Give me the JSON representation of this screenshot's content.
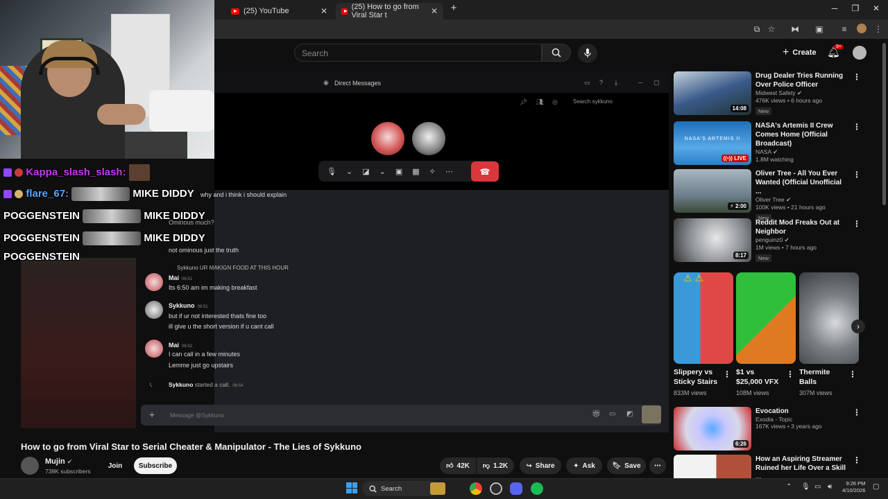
{
  "browser": {
    "tabs": [
      {
        "title": "(25) YouTube"
      },
      {
        "title": "(25) How to go from Viral Star t"
      }
    ],
    "new_tab": "+"
  },
  "youtube_header": {
    "search_placeholder": "Search",
    "create_label": "Create",
    "notification_count": "9+"
  },
  "discord": {
    "title": "Direct Messages",
    "search_placeholder": "Search sykkuno",
    "messages": [
      {
        "text": "why and i think i should explain"
      },
      {
        "text": "Ominous much?"
      },
      {
        "text": "not ominous just the truth"
      },
      {
        "reply": "Sykkuno UR MAKIGN FOOD AT THIS HOUR"
      },
      {
        "author": "Mai",
        "time": "06:51",
        "lines": [
          "Its 6:50 am im making breakfast"
        ]
      },
      {
        "author": "Sykkuno",
        "time": "06:51",
        "lines": [
          "but if ur not interested thats fine too",
          "ill give u the short version if u cant call"
        ]
      },
      {
        "author": "Mai",
        "time": "06:52",
        "lines": [
          "I can call in a few minutes",
          "Lemme just go upstairs"
        ]
      },
      {
        "system_user": "Sykkuno",
        "system_text": "started a call.",
        "time": "06:54"
      }
    ],
    "composer_placeholder": "Message @Sykkuno"
  },
  "stream_chat": [
    {
      "user": "Kappa_slash_slash:",
      "user_color": "#c43cf0"
    },
    {
      "user": "flare_67:",
      "user_color": "#5aa9ff",
      "emote_text": "MIKE DIDDY"
    },
    {
      "text": "POGGENSTEIN",
      "emote_text": "MIKE DIDDY"
    },
    {
      "text": "POGGENSTEIN",
      "emote_text": "MIKE DIDDY"
    },
    {
      "text": "POGGENSTEIN"
    }
  ],
  "video": {
    "title": "How to go from Viral Star to Serial Cheater & Manipulator - The Lies of Sykkuno",
    "channel": "Mujin",
    "subscribers": "738K subscribers",
    "join_label": "Join",
    "subscribe_label": "Subscribe",
    "likes": "42K",
    "dislikes": "1.2K",
    "share_label": "Share",
    "ask_label": "Ask",
    "save_label": "Save"
  },
  "related": [
    {
      "title": "Drug Dealer Tries Running Over Police Officer",
      "channel": "Midwest Safety",
      "meta": "476K views • 6 hours ago",
      "duration": "14:08",
      "badge": "New",
      "color": "#3a5a8a"
    },
    {
      "title": "NASA's Artemis II Crew Comes Home (Official Broadcast)",
      "channel": "NASA",
      "meta": "1.8M watching",
      "live": "LIVE",
      "thumb_text": "NASA'S ARTEMIS II",
      "color": "#2a7fc4"
    },
    {
      "title": "Oliver Tree - All You Ever Wanted (Official Unofficial ...",
      "channel": "Oliver Tree",
      "meta": "100K views • 21 hours ago",
      "duration": "2:00",
      "badge": "New",
      "color": "#6d7f8c"
    },
    {
      "title": "Reddit Mod Freaks Out at Neighbor",
      "channel": "penguinz0",
      "meta": "1M views • 7 hours ago",
      "duration": "8:17",
      "badge": "New",
      "color": "#8a8f94"
    }
  ],
  "shorts": [
    {
      "title": "Slippery vs Sticky Stairs",
      "views": "833M views",
      "color": "#c84646"
    },
    {
      "title": "$1 vs $25,000 VFX",
      "views": "108M views",
      "color": "#2fbf3a"
    },
    {
      "title": "Thermite Balls",
      "views": "307M views",
      "color": "#7a7f84"
    }
  ],
  "related_more": [
    {
      "title": "Evocation",
      "channel": "Exodia - Topic",
      "meta": "167K views • 3 years ago",
      "duration": "6:26",
      "color": "#d7d7e8"
    },
    {
      "title": "How an Aspiring Streamer Ruined her Life Over a Skill ...",
      "color": "#d8cfc6"
    }
  ],
  "taskbar": {
    "search_label": "Search",
    "time": "9:26 PM",
    "date": "4/10/2026"
  },
  "colors": {
    "youtube_red": "#ff0000",
    "discord_hangup": "#da373c",
    "live_red": "#cc0000"
  }
}
